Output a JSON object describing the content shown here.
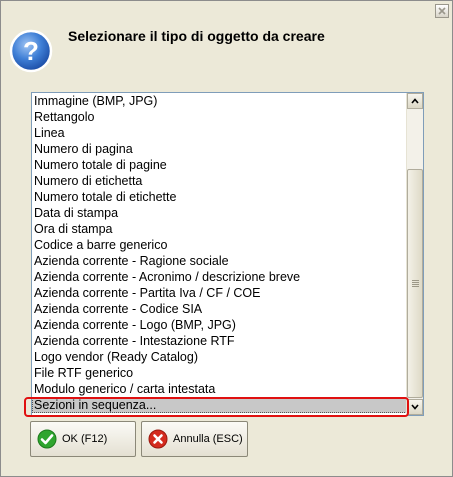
{
  "dialog": {
    "title": "Selezionare il tipo di oggetto da creare",
    "icon": "question-icon"
  },
  "list": {
    "items": [
      "Immagine (BMP, JPG)",
      "Rettangolo",
      "Linea",
      "Numero di pagina",
      "Numero totale di pagine",
      "Numero di etichetta",
      "Numero totale di etichette",
      "Data di stampa",
      "Ora di stampa",
      "Codice a barre generico",
      "Azienda corrente - Ragione sociale",
      "Azienda corrente - Acronimo / descrizione breve",
      "Azienda corrente - Partita Iva / CF / COE",
      "Azienda corrente - Codice SIA",
      "Azienda corrente - Logo (BMP, JPG)",
      "Azienda corrente - Intestazione RTF",
      "Logo vendor (Ready Catalog)",
      "File RTF generico",
      "Modulo generico / carta intestata",
      "Sezioni in sequenza..."
    ],
    "selected_item": "Sezioni in sequenza..."
  },
  "buttons": {
    "ok_label": "OK (F12)",
    "cancel_label": "Annulla (ESC)"
  },
  "colors": {
    "window_bg": "#ECE9D8",
    "highlight": "#e01010",
    "ok_icon": "#2fa52f",
    "cancel_icon": "#d42b1e"
  }
}
